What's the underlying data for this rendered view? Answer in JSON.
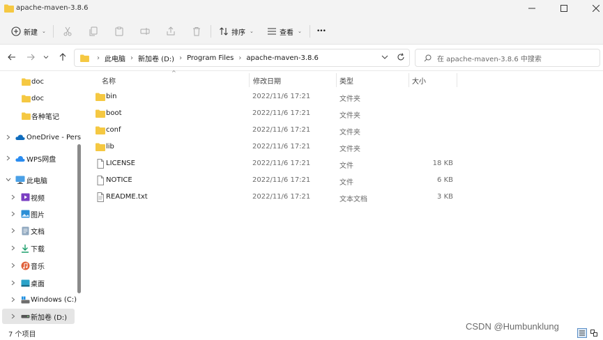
{
  "window": {
    "title": "apache-maven-3.8.6"
  },
  "toolbar": {
    "new_label": "新建",
    "sort_label": "排序",
    "view_label": "查看",
    "more_label": "•••"
  },
  "address": {
    "crumbs": [
      "此电脑",
      "新加卷 (D:)",
      "Program Files",
      "apache-maven-3.8.6"
    ],
    "search_placeholder": "在 apache-maven-3.8.6 中搜索"
  },
  "sidebar": {
    "items": [
      {
        "label": "doc",
        "icon": "folder-icon"
      },
      {
        "label": "doc",
        "icon": "folder-icon"
      },
      {
        "label": "各种笔记",
        "icon": "folder-icon"
      },
      {
        "label": "OneDrive - Pers",
        "icon": "onedrive-icon"
      },
      {
        "label": "WPS网盘",
        "icon": "wps-cloud-icon"
      },
      {
        "label": "此电脑",
        "icon": "computer-icon"
      },
      {
        "label": "视频",
        "icon": "videos-icon"
      },
      {
        "label": "图片",
        "icon": "pictures-icon"
      },
      {
        "label": "文档",
        "icon": "documents-icon"
      },
      {
        "label": "下载",
        "icon": "downloads-icon"
      },
      {
        "label": "音乐",
        "icon": "music-icon"
      },
      {
        "label": "桌面",
        "icon": "desktop-icon"
      },
      {
        "label": "Windows (C:)",
        "icon": "windows-drive-icon"
      },
      {
        "label": "新加卷 (D:)",
        "icon": "drive-icon"
      }
    ]
  },
  "columns": {
    "name": "名称",
    "date": "修改日期",
    "type": "类型",
    "size": "大小"
  },
  "files": [
    {
      "name": "bin",
      "date": "2022/11/6 17:21",
      "type": "文件夹",
      "size": "",
      "icon": "folder-icon"
    },
    {
      "name": "boot",
      "date": "2022/11/6 17:21",
      "type": "文件夹",
      "size": "",
      "icon": "folder-icon"
    },
    {
      "name": "conf",
      "date": "2022/11/6 17:21",
      "type": "文件夹",
      "size": "",
      "icon": "folder-icon"
    },
    {
      "name": "lib",
      "date": "2022/11/6 17:21",
      "type": "文件夹",
      "size": "",
      "icon": "folder-icon"
    },
    {
      "name": "LICENSE",
      "date": "2022/11/6 17:21",
      "type": "文件",
      "size": "18 KB",
      "icon": "file-icon"
    },
    {
      "name": "NOTICE",
      "date": "2022/11/6 17:21",
      "type": "文件",
      "size": "6 KB",
      "icon": "file-icon"
    },
    {
      "name": "README.txt",
      "date": "2022/11/6 17:21",
      "type": "文本文档",
      "size": "3 KB",
      "icon": "text-file-icon"
    }
  ],
  "status": {
    "item_count": "7 个项目"
  },
  "watermark": "CSDN @Humbunklung",
  "colors": {
    "folder": "#f5c842",
    "accent": "#0067c0",
    "selected": "#e5e5e5"
  }
}
